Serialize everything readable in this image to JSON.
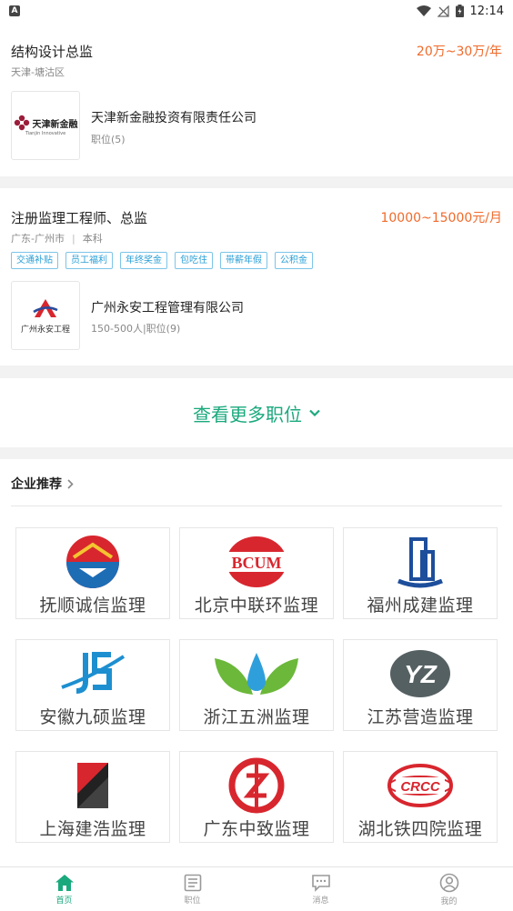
{
  "status_bar": {
    "time": "12:14",
    "app_badge": "A"
  },
  "jobs": [
    {
      "title": "结构设计总监",
      "salary": "20万~30万/年",
      "location": "天津-塘沽区",
      "education": "",
      "tags": [],
      "company": {
        "name": "天津新金融投资有限责任公司",
        "sub": "职位(5)",
        "logo_text": "天津新金融",
        "logo_sub": "Tianjin Innovative"
      }
    },
    {
      "title": "注册监理工程师、总监",
      "salary": "10000~15000元/月",
      "location": "广东-广州市",
      "education": "本科",
      "tags": [
        "交通补贴",
        "员工福利",
        "年终奖金",
        "包吃住",
        "带薪年假",
        "公积金"
      ],
      "company": {
        "name": "广州永安工程管理有限公司",
        "sub": "150-500人|职位(9)",
        "logo_text": "广州永安工程"
      }
    }
  ],
  "more_jobs": {
    "label": "查看更多职位"
  },
  "recommend": {
    "title": "企业推荐",
    "companies": [
      {
        "name": "抚顺诚信监理"
      },
      {
        "name": "北京中联环监理",
        "logo_text": "BCUM"
      },
      {
        "name": "福州成建监理"
      },
      {
        "name": "安徽九硕监理"
      },
      {
        "name": "浙江五洲监理"
      },
      {
        "name": "江苏营造监理",
        "logo_text": "YZ"
      },
      {
        "name": "上海建浩监理"
      },
      {
        "name": "广东中致监理"
      },
      {
        "name": "湖北铁四院监理",
        "logo_text": "CRCC"
      }
    ]
  },
  "tabs": [
    {
      "label": "首页",
      "active": true
    },
    {
      "label": "职位",
      "active": false
    },
    {
      "label": "消息",
      "active": false
    },
    {
      "label": "我的",
      "active": false
    }
  ],
  "colors": {
    "accent": "#1aa97d",
    "salary": "#f06a2a",
    "tag": "#2a9fd6"
  }
}
